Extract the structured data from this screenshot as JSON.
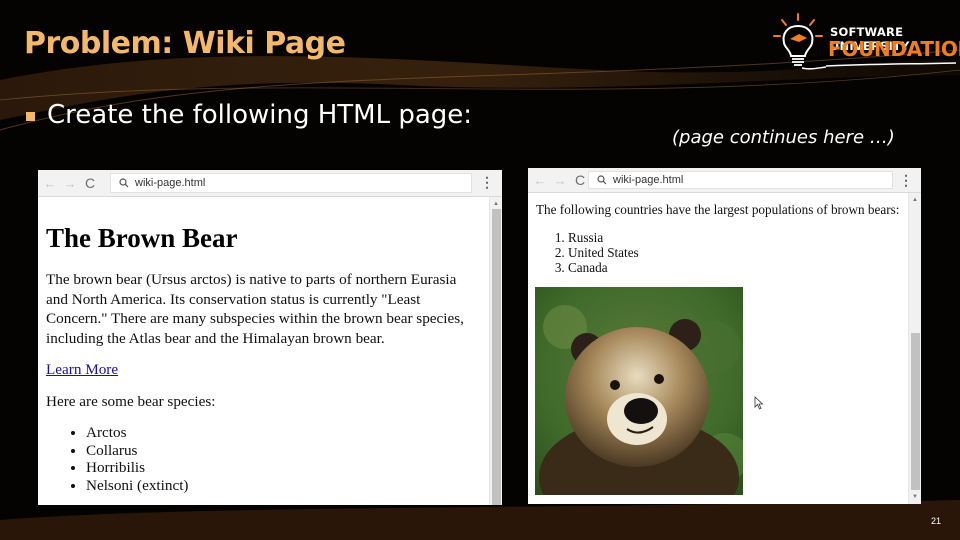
{
  "slide": {
    "title": "Problem: Wiki Page",
    "bullet": "Create the following HTML page:",
    "continues_note": "(page continues here …)",
    "page_number": "21",
    "accent_color": "#f4b86a"
  },
  "logo": {
    "line1": "SOFTWARE UNIVERSITY",
    "line2": "FOUNDATION",
    "icon": "lightbulb-graduation-cap-icon",
    "brand_color": "#f07d1e"
  },
  "browser_left": {
    "address": "wiki-page.html",
    "nav": {
      "back": "←",
      "forward": "→",
      "reload": "C",
      "menu": "⋮"
    },
    "page": {
      "heading": "The Brown Bear",
      "intro": "The brown bear (Ursus arctos) is native to parts of northern Eurasia and North America. Its conservation status is currently \"Least Concern.\" There are many subspecies within the brown bear species, including the Atlas bear and the Himalayan brown bear.",
      "link_text": "Learn More",
      "species_intro": "Here are some bear species:",
      "species": [
        "Arctos",
        "Collarus",
        "Horribilis",
        "Nelsoni (extinct)"
      ]
    }
  },
  "browser_right": {
    "address": "wiki-page.html",
    "nav": {
      "back": "←",
      "forward": "→",
      "reload": "C",
      "menu": "⋮"
    },
    "page": {
      "countries_intro": "The following countries have the largest populations of brown bears:",
      "countries": [
        "Russia",
        "United States",
        "Canada"
      ],
      "image_alt": "brown bear photo"
    }
  }
}
